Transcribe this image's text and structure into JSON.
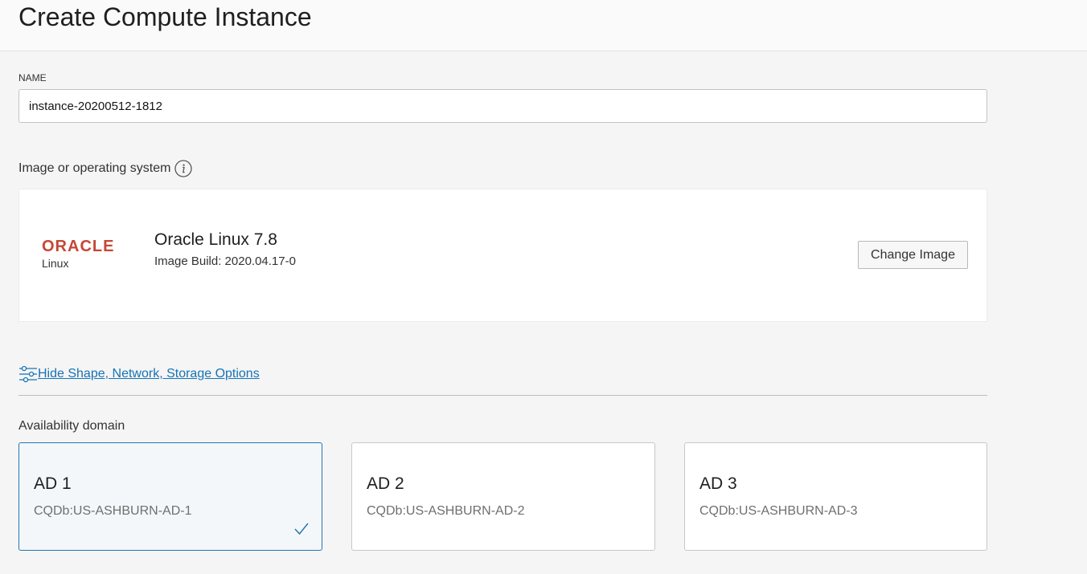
{
  "header": {
    "title": "Create Compute Instance"
  },
  "name_field": {
    "label": "NAME",
    "value": "instance-20200512-1812"
  },
  "image_section": {
    "label": "Image or operating system",
    "info_icon": "info-icon",
    "image": {
      "logo_word": "ORACLE",
      "logo_sub": "Linux",
      "name": "Oracle Linux 7.8",
      "build": "Image Build: 2020.04.17-0"
    },
    "change_button": "Change Image"
  },
  "options_toggle": {
    "icon": "sliders-icon",
    "label": "Hide Shape, Network, Storage Options"
  },
  "availability_domain": {
    "label": "Availability domain",
    "options": [
      {
        "title": "AD 1",
        "sub": "CQDb:US-ASHBURN-AD-1",
        "selected": true
      },
      {
        "title": "AD 2",
        "sub": "CQDb:US-ASHBURN-AD-2",
        "selected": false
      },
      {
        "title": "AD 3",
        "sub": "CQDb:US-ASHBURN-AD-3",
        "selected": false
      }
    ]
  },
  "colors": {
    "link": "#1673b5",
    "brand_red": "#c74634",
    "selected_border": "#2276b0"
  }
}
